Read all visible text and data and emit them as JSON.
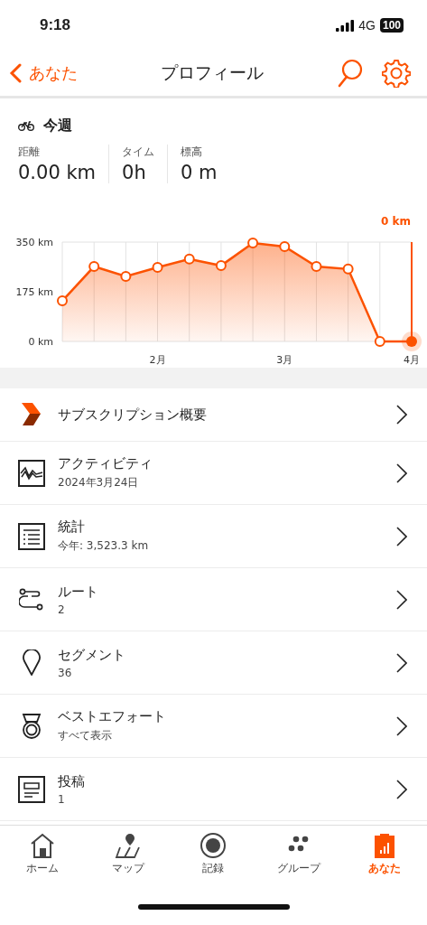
{
  "status_bar": {
    "time": "9:18",
    "network": "4G",
    "battery": "100"
  },
  "nav": {
    "back_label": "あなた",
    "title": "プロフィール"
  },
  "week": {
    "title": "今週",
    "stats": [
      {
        "label": "距離",
        "value": "0.00 km"
      },
      {
        "label": "タイム",
        "value": "0h"
      },
      {
        "label": "標高",
        "value": "0 m"
      }
    ]
  },
  "chart": {
    "selected_value": "0 km",
    "chart_data": {
      "type": "area",
      "categories": [
        null,
        null,
        null,
        "2月",
        null,
        null,
        null,
        "3月",
        null,
        null,
        null,
        "4月"
      ],
      "series": [
        {
          "color": "#fc5200",
          "values": [
            143,
            264,
            229,
            261,
            290,
            267,
            347,
            334,
            264,
            255,
            0,
            0
          ]
        }
      ],
      "ylim": [
        0,
        350
      ],
      "grid": true,
      "yticks": [
        {
          "value": 0,
          "label": "0 km"
        },
        {
          "value": 175,
          "label": "175 km"
        },
        {
          "value": 350,
          "label": "350 km"
        }
      ]
    }
  },
  "menu": [
    {
      "kind": "subscription",
      "title": "サブスクリプション概要"
    },
    {
      "kind": "activity",
      "title": "アクティビティ",
      "subtitle": "2024年3月24日"
    },
    {
      "kind": "stats",
      "title": "統計",
      "subtitle": "今年: 3,523.3 km"
    },
    {
      "kind": "route",
      "title": "ルート",
      "subtitle": "2"
    },
    {
      "kind": "segment",
      "title": "セグメント",
      "subtitle": "36"
    },
    {
      "kind": "medal",
      "title": "ベストエフォート",
      "subtitle": "すべて表示"
    },
    {
      "kind": "post",
      "title": "投稿",
      "subtitle": "1"
    }
  ],
  "tab_bar": [
    {
      "kind": "home",
      "label": "ホーム",
      "selected": false
    },
    {
      "kind": "map",
      "label": "マップ",
      "selected": false
    },
    {
      "kind": "record",
      "label": "記録",
      "selected": false
    },
    {
      "kind": "group",
      "label": "グループ",
      "selected": false
    },
    {
      "kind": "you",
      "label": "あなた",
      "selected": true
    }
  ]
}
